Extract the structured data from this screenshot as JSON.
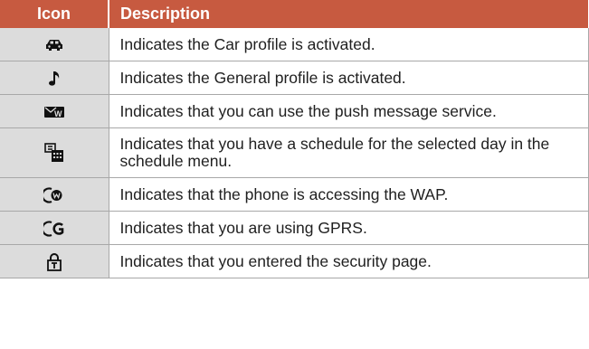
{
  "table": {
    "header_icon": "Icon",
    "header_description": "Description",
    "rows": [
      {
        "icon": "car-icon",
        "description": "Indicates the Car profile is activated."
      },
      {
        "icon": "music-note-icon",
        "description": "Indicates the General profile is activated."
      },
      {
        "icon": "push-message-icon",
        "description": "Indicates that you can use the push message service."
      },
      {
        "icon": "schedule-icon",
        "description": "Indicates that you have a schedule for the selected day in the schedule menu."
      },
      {
        "icon": "wap-icon",
        "description": "Indicates that the phone is accessing the WAP."
      },
      {
        "icon": "gprs-icon",
        "description": "Indicates that you are using GPRS."
      },
      {
        "icon": "security-lock-icon",
        "description": "Indicates that you entered the security page."
      }
    ]
  },
  "colors": {
    "header_background": "#c75a40",
    "icon_cell_background": "#dcdcdc",
    "border": "#a8a8a8"
  }
}
